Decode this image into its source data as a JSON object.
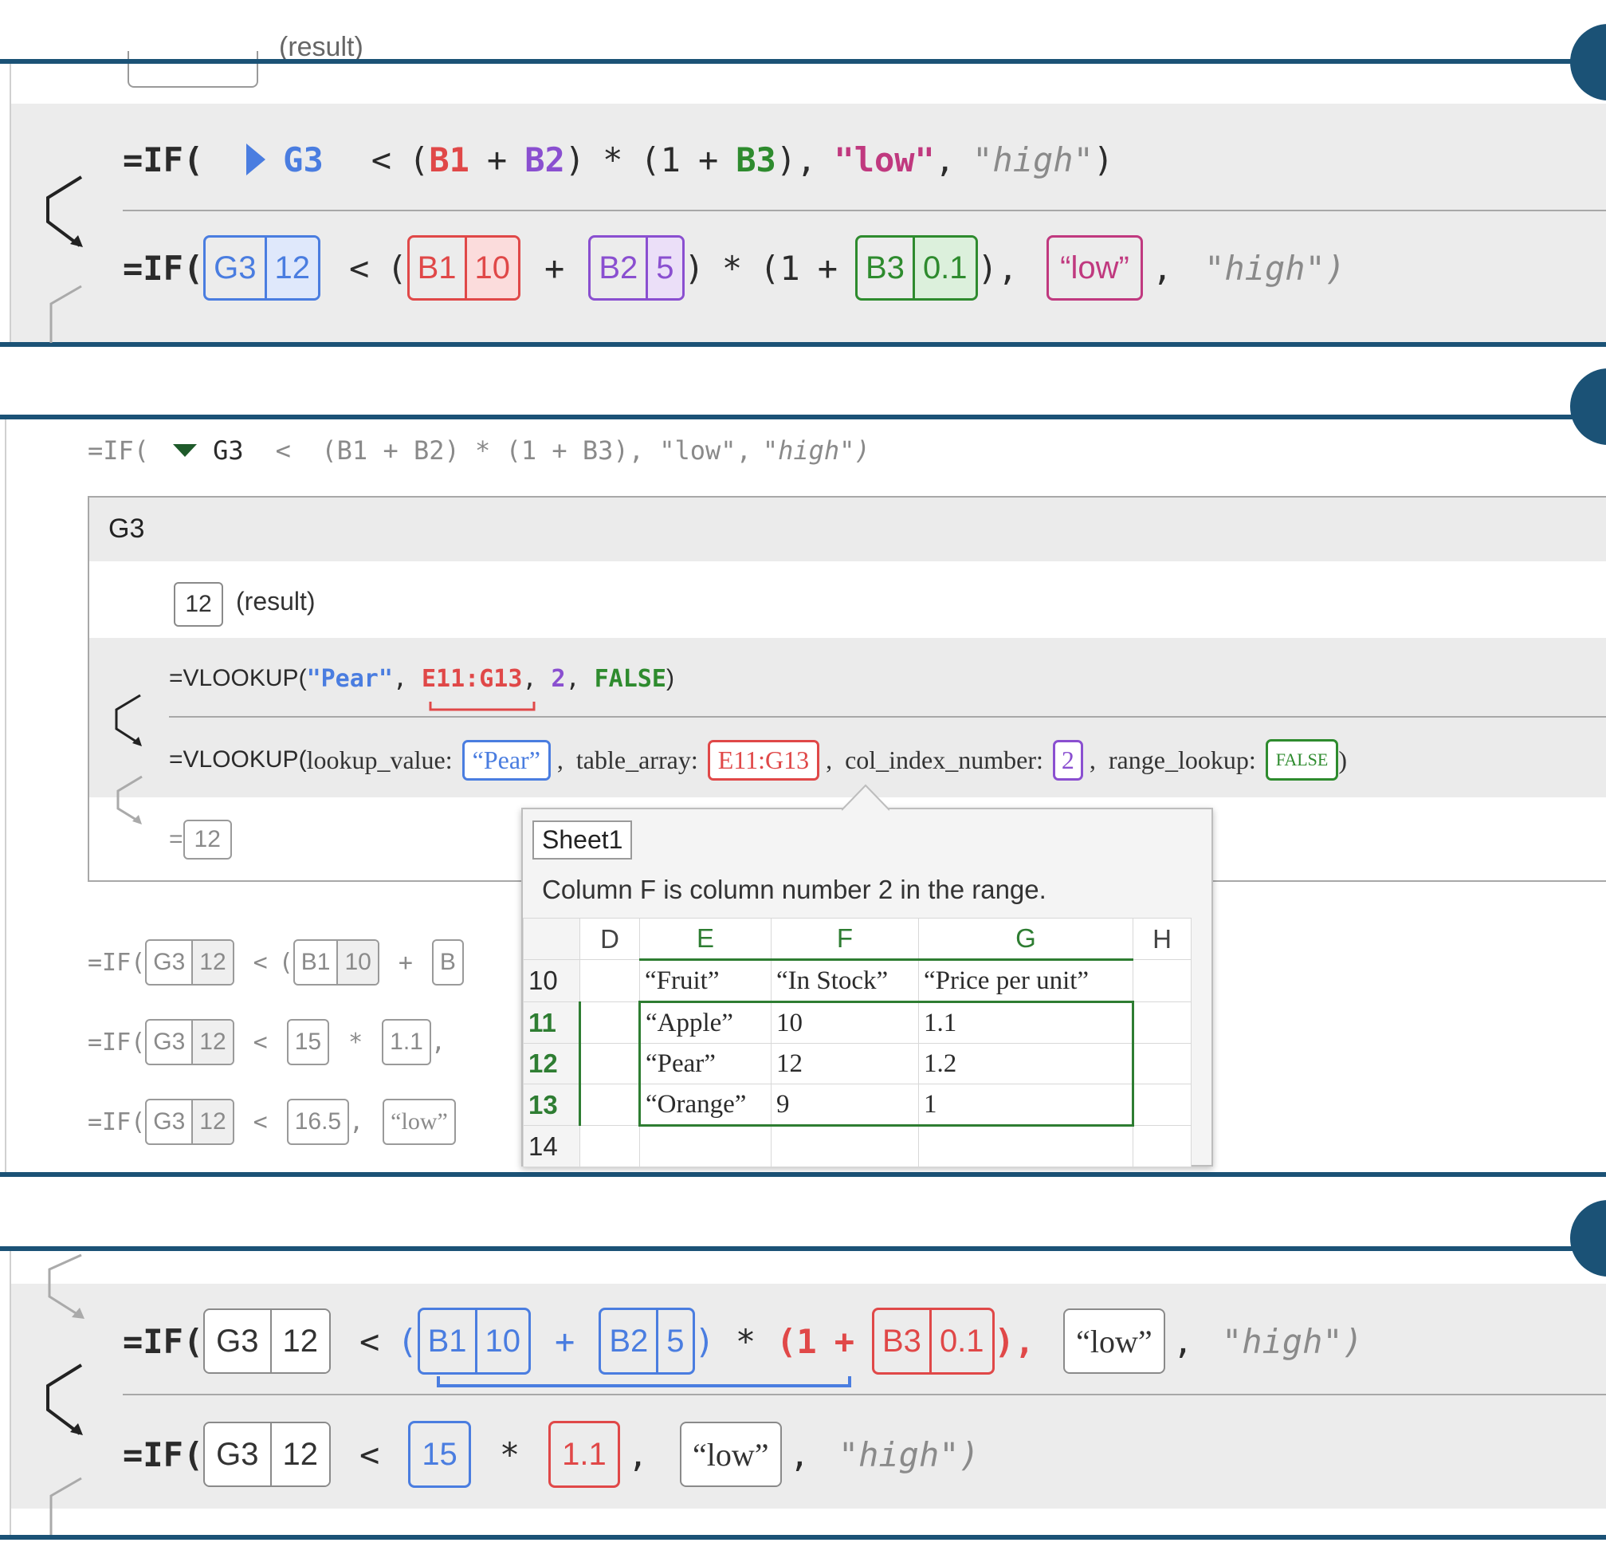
{
  "colors": {
    "frame": "#1b5276",
    "panel_bg": "#ececec",
    "blue": "#4a7de0",
    "red": "#e04848",
    "purple": "#8a4fd0",
    "green": "#2e8b2e",
    "magenta": "#c0397f"
  },
  "panel1": {
    "top_result": "(result)",
    "row1": {
      "prefix": "=IF(",
      "triangle_icon": "right-triangle",
      "ref": "G3",
      "lt": "<",
      "open": "(",
      "b1": "B1",
      "plus": "+",
      "b2": "B2",
      "close": ")",
      "times": "*",
      "open2": "(1",
      "plus2": "+",
      "b3": "B3",
      "close2": "),",
      "low": "\"low\"",
      "comma": ",",
      "high": "\"high\"",
      "end": ")"
    },
    "row2": {
      "prefix": "=IF(",
      "g3": "G3",
      "g3_val": "12",
      "lt": "<",
      "open": "(",
      "b1": "B1",
      "b1_val": "10",
      "plus": "+",
      "b2": "B2",
      "b2_val": "5",
      "close": ")",
      "times": "*",
      "open2": "(1",
      "plus2": "+",
      "b3": "B3",
      "b3_val": "0.1",
      "close2": "),",
      "low": "“low”",
      "comma": ",",
      "high": "\"high\")"
    }
  },
  "panel2": {
    "formula": {
      "prefix": "=IF(",
      "triangle_icon": "down-triangle",
      "ref": "G3",
      "rest": "<  (B1 + B2) * (1 + B3), \"low\",",
      "high": "\"high\")"
    },
    "card": {
      "title": "G3",
      "result_value": "12",
      "result_label": "(result)",
      "vlookup1": {
        "fn": "=VLOOKUP(",
        "arg1": "\"Pear\"",
        "c1": ",",
        "arg2": "E11:G13",
        "c2": ",",
        "arg3": "2",
        "c3": ",",
        "arg4": "FALSE",
        "end": ")"
      },
      "vlookup2": {
        "fn": "=VLOOKUP(",
        "p1": "lookup_value:",
        "v1": "“Pear”",
        "c1": ",",
        "p2": "table_array:",
        "v2": "E11:G13",
        "c2": ",",
        "p3": "col_index_number:",
        "v3": "2",
        "c3": ",",
        "p4": "range_lookup:",
        "v4": "FALSE",
        "end": ")"
      },
      "eval": {
        "eq": "=",
        "value": "12"
      }
    },
    "steps": [
      {
        "prefix": "=IF(",
        "g3": "G3",
        "g3v": "12",
        "lt": "<",
        "open": "(",
        "b1": "B1",
        "b1v": "10",
        "plus": "+",
        "b": "B"
      },
      {
        "prefix": "=IF(",
        "g3": "G3",
        "g3v": "12",
        "lt": "<",
        "a": "15",
        "times": "*",
        "b": "1.1",
        "comma": ","
      },
      {
        "prefix": "=IF(",
        "g3": "G3",
        "g3v": "12",
        "lt": "<",
        "a": "16.5",
        "comma": ",",
        "low": "“low”"
      }
    ],
    "popup": {
      "sheet": "Sheet1",
      "desc": "Column F is column number 2 in the range.",
      "columns": [
        "D",
        "E",
        "F",
        "G",
        "H"
      ],
      "rows": [
        {
          "num": "10",
          "cells": [
            "",
            "“Fruit”",
            "“In Stock”",
            "“Price per unit”",
            ""
          ]
        },
        {
          "num": "11",
          "cells": [
            "",
            "“Apple”",
            "10",
            "1.1",
            ""
          ]
        },
        {
          "num": "12",
          "cells": [
            "",
            "“Pear”",
            "12",
            "1.2",
            ""
          ]
        },
        {
          "num": "13",
          "cells": [
            "",
            "“Orange”",
            "9",
            "1",
            ""
          ]
        },
        {
          "num": "14",
          "cells": [
            "",
            "",
            "",
            "",
            ""
          ]
        }
      ]
    }
  },
  "panel3": {
    "row1": {
      "prefix": "=IF(",
      "g3": "G3",
      "g3v": "12",
      "lt": "<",
      "open": "(",
      "b1": "B1",
      "b1v": "10",
      "plus": "+",
      "b2": "B2",
      "b2v": "5",
      "close": ")",
      "times": "*",
      "open2": "(1",
      "plus2": "+",
      "b3": "B3",
      "b3v": "0.1",
      "close2": "),",
      "low": "“low”",
      "comma": ",",
      "high": "\"high\")"
    },
    "row2": {
      "prefix": "=IF(",
      "g3": "G3",
      "g3v": "12",
      "lt": "<",
      "a": "15",
      "times": "*",
      "b": "1.1",
      "comma": ",",
      "low": "“low”",
      "comma2": ",",
      "high": "\"high\")"
    }
  }
}
